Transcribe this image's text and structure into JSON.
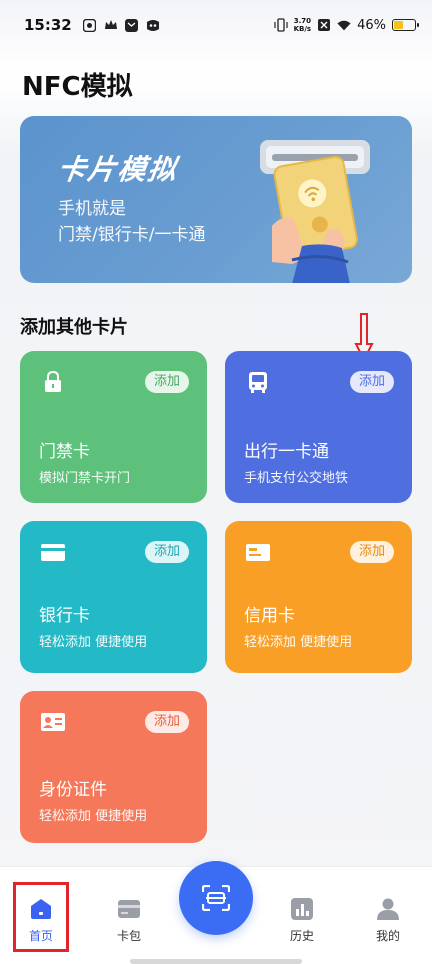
{
  "status_bar": {
    "time": "15:32",
    "net_speed_value": "3.70",
    "net_speed_unit": "KB/s",
    "battery_percent": "46%",
    "battery_level": 0.46
  },
  "page_title": "NFC模拟",
  "banner": {
    "title": "卡片模拟",
    "line1": "手机就是",
    "line2": "门禁/银行卡/一卡通"
  },
  "section_title": "添加其他卡片",
  "cards": [
    {
      "title": "门禁卡",
      "desc": "模拟门禁卡开门",
      "button": "添加",
      "icon": "lock-icon",
      "color": "#5ec17b"
    },
    {
      "title": "出行一卡通",
      "desc": "手机支付公交地铁",
      "button": "添加",
      "icon": "bus-icon",
      "color": "#4f6fe0"
    },
    {
      "title": "银行卡",
      "desc": "轻松添加 便捷使用",
      "button": "添加",
      "icon": "bank-card-icon",
      "color": "#23b9c7"
    },
    {
      "title": "信用卡",
      "desc": "轻松添加 便捷使用",
      "button": "添加",
      "icon": "credit-card-icon",
      "color": "#fa9f25"
    },
    {
      "title": "身份证件",
      "desc": "轻松添加 便捷使用",
      "button": "添加",
      "icon": "id-card-icon",
      "color": "#f5785a"
    }
  ],
  "nav": {
    "home": "首页",
    "wallet": "卡包",
    "history": "历史",
    "mine": "我的"
  },
  "colors": {
    "accent": "#3a6cf4",
    "highlight_annotation": "#e0262a"
  }
}
